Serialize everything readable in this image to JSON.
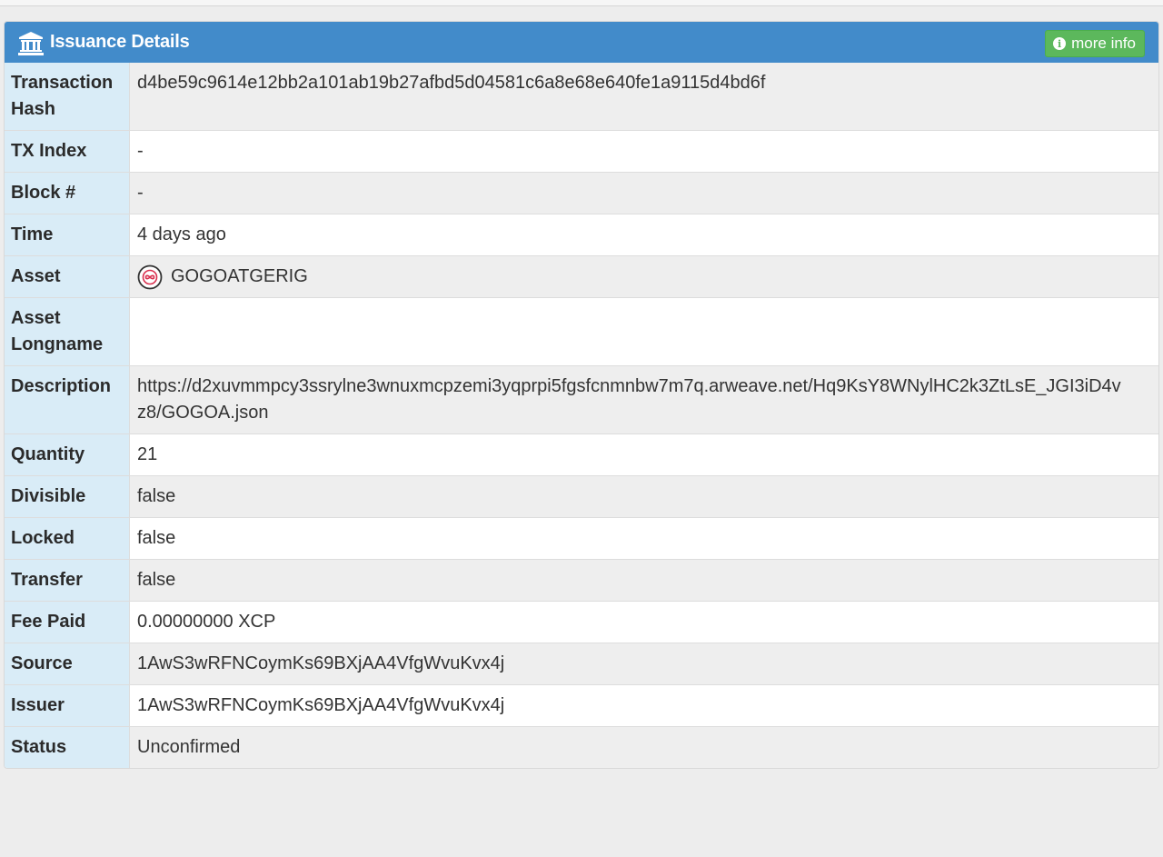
{
  "panel": {
    "title": "Issuance Details",
    "more_info_label": "more info",
    "header_color": "#428bca",
    "button_color": "#5cb85c",
    "title_icon": "bank-icon",
    "button_icon": "info-icon"
  },
  "rows": [
    {
      "label": "Transaction Hash",
      "value": "d4be59c9614e12bb2a101ab19b27afbd5d04581c6a8e68e640fe1a9115d4bd6f"
    },
    {
      "label": "TX Index",
      "value": "-"
    },
    {
      "label": "Block #",
      "value": "-"
    },
    {
      "label": "Time",
      "value": "4 days ago"
    },
    {
      "label": "Asset",
      "value": "GOGOATGERIG",
      "icon": "asset-icon"
    },
    {
      "label": "Asset Longname",
      "value": ""
    },
    {
      "label": "Description",
      "value_line1": "https://d2xuvmmpcy3ssrylne3wnuxmcpzemi3yqprpi5fgsfcnmnbw7m7q.arweave.net/Hq9KsY8WNylHC2k3ZtLsE_JGI3iD4v",
      "value_line2": "z8/GOGOA.json"
    },
    {
      "label": "Quantity",
      "value": "21"
    },
    {
      "label": "Divisible",
      "value": "false"
    },
    {
      "label": "Locked",
      "value": "false"
    },
    {
      "label": "Transfer",
      "value": "false"
    },
    {
      "label": "Fee Paid",
      "value": "0.00000000 XCP"
    },
    {
      "label": "Source",
      "value": "1AwS3wRFNCoymKs69BXjAA4VfgWvuKvx4j"
    },
    {
      "label": "Issuer",
      "value": "1AwS3wRFNCoymKs69BXjAA4VfgWvuKvx4j"
    },
    {
      "label": "Status",
      "value": "Unconfirmed"
    }
  ]
}
